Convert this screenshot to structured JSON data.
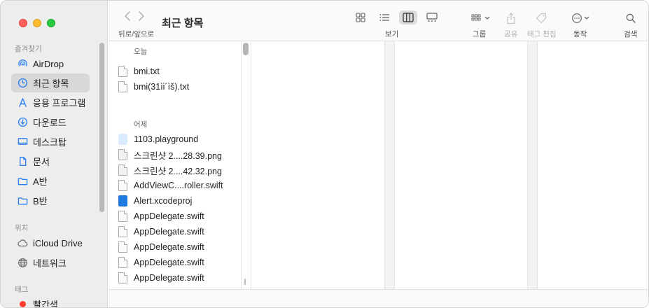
{
  "toolbar": {
    "title": "최근 항목",
    "nav_label": "뒤로/앞으로",
    "view_label": "보기",
    "group_label": "그룹",
    "share_label": "공유",
    "tag_edit_label": "태그 편집",
    "action_label": "동작",
    "search_label": "검색"
  },
  "sidebar": {
    "favorites_header": "즐겨찾기",
    "favorites": [
      {
        "label": "AirDrop",
        "icon": "airdrop-icon"
      },
      {
        "label": "최근 항목",
        "icon": "clock-icon"
      },
      {
        "label": "응용 프로그램",
        "icon": "applications-icon"
      },
      {
        "label": "다운로드",
        "icon": "download-icon"
      },
      {
        "label": "데스크탑",
        "icon": "desktop-icon"
      },
      {
        "label": "문서",
        "icon": "document-icon"
      },
      {
        "label": "A반",
        "icon": "folder-icon"
      },
      {
        "label": "B반",
        "icon": "folder-icon"
      }
    ],
    "locations_header": "위치",
    "locations": [
      {
        "label": "iCloud Drive",
        "icon": "cloud-icon"
      },
      {
        "label": "네트워크",
        "icon": "globe-icon"
      }
    ],
    "tags_header": "태그",
    "tags": [
      {
        "label": "빨간색",
        "color": "#ff3b30"
      }
    ]
  },
  "files": {
    "today_header": "오늘",
    "today": [
      "bmi.txt",
      "bmi(31ìi´ìš).txt"
    ],
    "yesterday_header": "어제",
    "yesterday": [
      "1103.playground",
      "스크린샷 2....28.39.png",
      "스크린샷 2....42.32.png",
      "AddViewC....roller.swift",
      "Alert.xcodeproj",
      "AppDelegate.swift",
      "AppDelegate.swift",
      "AppDelegate.swift",
      "AppDelegate.swift",
      "AppDelegate.swift"
    ]
  },
  "colors": {
    "accent": "#2a7ff7",
    "sidebar_bg": "#ededed",
    "selected_bg": "#d8d8d8"
  }
}
